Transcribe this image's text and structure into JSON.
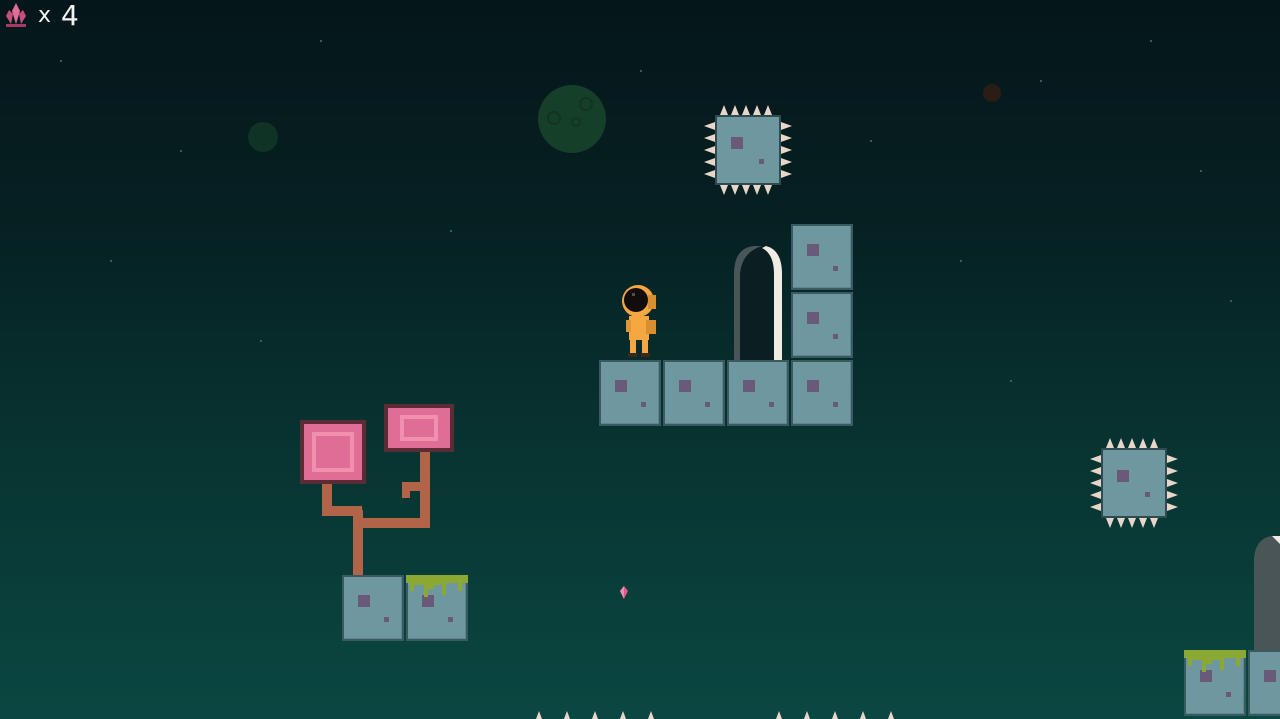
{
  "hud": {
    "collectible_icon": "pink-crystal-icon",
    "multiplier": "x",
    "count": "4"
  },
  "colors": {
    "sky_top": "#05161a",
    "sky_bottom": "#0b4742",
    "stone": "#6e97a0",
    "player": "#f5a842",
    "tree_leaf": "#e06d95",
    "crystal": "#e05a8a"
  }
}
